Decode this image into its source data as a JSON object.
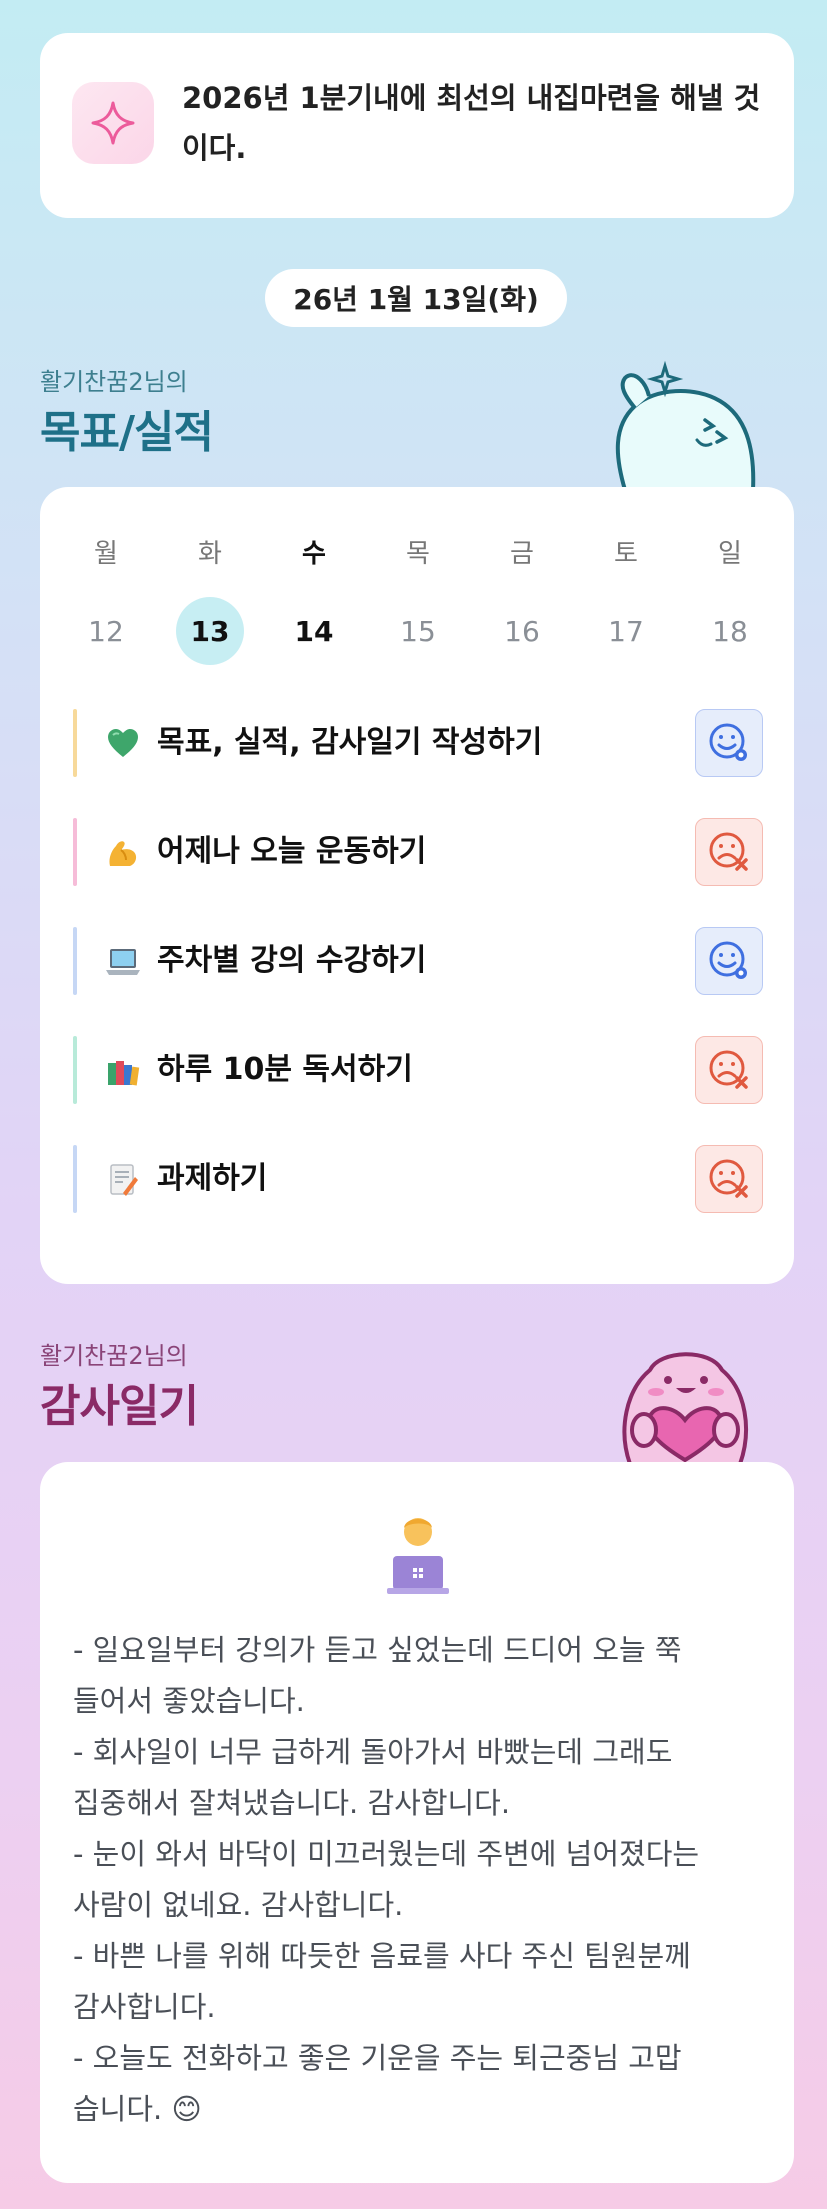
{
  "goal": {
    "icon": "sparkle-icon",
    "text": "2026년 1분기내에 최선의 내집마련을 해낼 것이다."
  },
  "date_label": "26년 1월 13일(화)",
  "goals_section": {
    "subtitle": "활기찬꿈2님의",
    "title": "목표/실적"
  },
  "week": {
    "days": [
      {
        "day": "월",
        "date": "12"
      },
      {
        "day": "화",
        "date": "13"
      },
      {
        "day": "수",
        "date": "14"
      },
      {
        "day": "목",
        "date": "15"
      },
      {
        "day": "금",
        "date": "16"
      },
      {
        "day": "토",
        "date": "17"
      },
      {
        "day": "일",
        "date": "18"
      }
    ]
  },
  "tasks": [
    {
      "emoji": "green-heart-icon",
      "label": "목표, 실적, 감사일기 작성하기",
      "status": "done",
      "bar_color": "#f7d99a"
    },
    {
      "emoji": "flexed-biceps-icon",
      "label": "어제나 오늘 운동하기",
      "status": "not-done",
      "bar_color": "#f6bcd8"
    },
    {
      "emoji": "laptop-icon",
      "label": "주차별 강의 수강하기",
      "status": "done",
      "bar_color": "#c6d7f5"
    },
    {
      "emoji": "books-icon",
      "label": "하루 10분 독서하기",
      "status": "not-done",
      "bar_color": "#b8ead9"
    },
    {
      "emoji": "memo-icon",
      "label": "과제하기",
      "status": "not-done",
      "bar_color": "#c6d7f5"
    }
  ],
  "gratitude_section": {
    "subtitle": "활기찬꿈2님의",
    "title": "감사일기"
  },
  "gratitude": {
    "icon": "person-with-laptop-icon",
    "lines": [
      "- 일요일부터 강의가 듣고 싶었는데 드디어 오늘 쭉\n들어서 좋았습니다.",
      "- 회사일이 너무 급하게 돌아가서 바빴는데 그래도\n집중해서 잘쳐냈습니다. 감사합니다.",
      "- 눈이 와서 바닥이 미끄러웠는데 주변에 넘어졌다는\n사람이 없네요. 감사합니다.",
      "- 바쁜 나를 위해 따듯한 음료를 사다 주신 팀원분께\n감사합니다.",
      "- 오늘도 전화하고 좋은 기운을 주는 퇴근중님 고맙\n습니다. 😊"
    ]
  }
}
